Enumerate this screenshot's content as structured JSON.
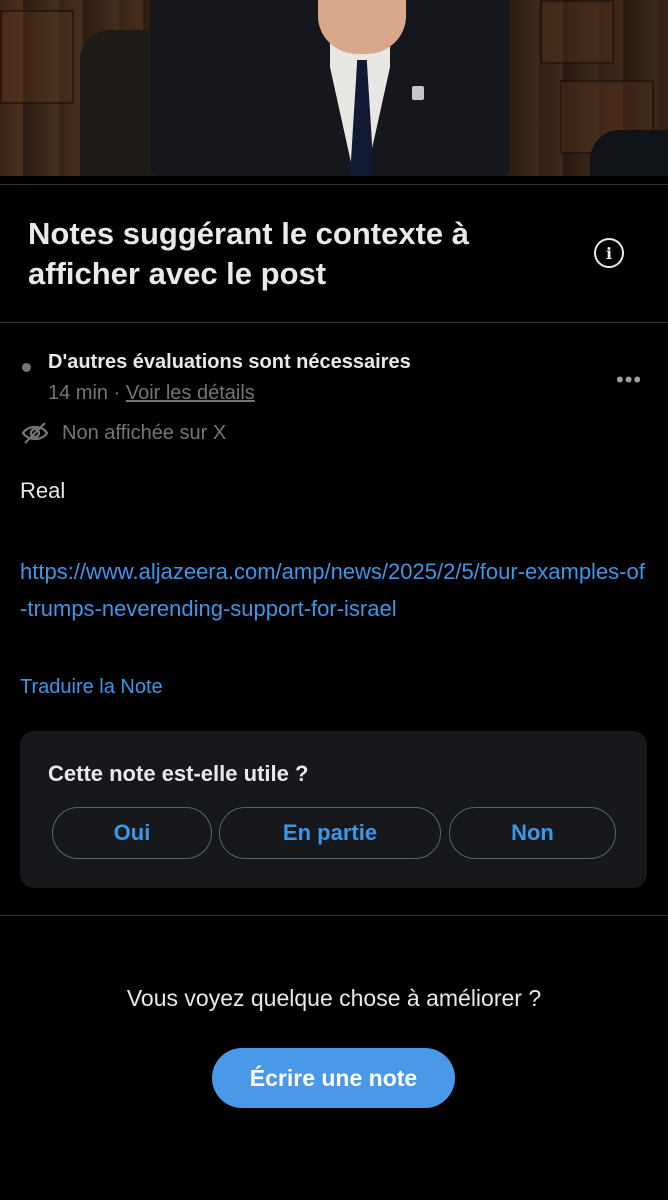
{
  "header": {
    "title": "Notes suggérant le contexte à afficher avec le post",
    "info_icon": "info-icon"
  },
  "note": {
    "status": "D'autres évaluations sont nécessaires",
    "time": "14 min",
    "separator": "·",
    "details_link": "Voir les détails",
    "visibility": "Non affichée sur X",
    "body": "Real",
    "url": "https://www.aljazeera.com/amp/news/2025/2/5/four-examples-of-trumps-neverending-support-for-israel",
    "translate": "Traduire la Note",
    "more_icon": "more-horizontal-icon"
  },
  "rating": {
    "question": "Cette note est-elle utile ?",
    "options": [
      "Oui",
      "En partie",
      "Non"
    ]
  },
  "footer": {
    "prompt": "Vous voyez quelque chose à améliorer ?",
    "cta": "Écrire une note"
  },
  "colors": {
    "background": "#000000",
    "link": "#3b97ea",
    "cta_bg": "#4a99e9",
    "card_bg": "#16181c",
    "muted": "#71767b"
  }
}
